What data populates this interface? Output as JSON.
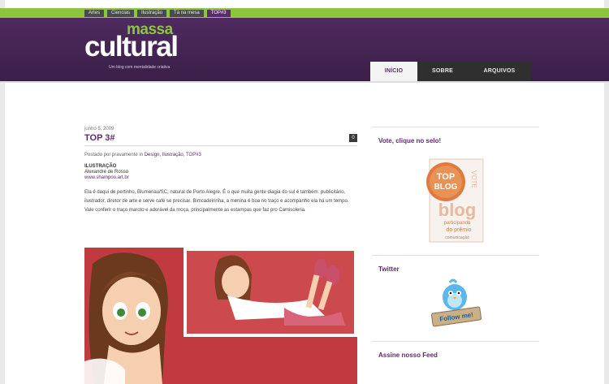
{
  "topnav": [
    "Artes",
    "Ciencias",
    "Ilustração",
    "Tá na mesa",
    "TOP#3"
  ],
  "logo": {
    "massa": "massa",
    "cultural": "cultural",
    "tagline": "Um blog com mentalidade criativa"
  },
  "mainnav": [
    {
      "label": "INÍCIO",
      "active": true
    },
    {
      "label": "SOBRE",
      "active": false
    },
    {
      "label": "ARQUIVOS",
      "active": false
    }
  ],
  "post": {
    "date": "junho 5, 2009",
    "title": "TOP 3#",
    "comment_count": "0",
    "meta_prefix": "Postado por pravamente in ",
    "meta_links": "Design, Ilustração, TOP#3",
    "section": "ILUSTRAÇÃO",
    "author": "Alexandre de Rosso",
    "url": "www.shampoo.art.br",
    "body": "Ela é daqui de pertinho, Blumenau/SC, natural de Porto Alegre. É o que muita gente diagia do sul é também: publicitário, ilustrador, diretor de arte e serve café se precisar. Bimcadeirinha, a menina é boa no traço e acompanho ela há um tempo. Vale conferir o traço maroto e adorável da moça, principalmente as estampas que faz pro Camisoleria."
  },
  "sidebar": {
    "vote_title": "Vote, clique no selo!",
    "badge": {
      "top": "TOP",
      "blog": "BLOG",
      "big": "blog",
      "line1": "participando",
      "line2": "do prêmio",
      "footer": "comunicação",
      "side": "VOTE"
    },
    "twitter_title": "Twitter",
    "twitter_button": "Follow me!",
    "feed_title": "Assine nosso Feed"
  },
  "colors": {
    "purple": "#5c2b6b",
    "green": "#8cc63f",
    "orange": "#e07a3e"
  }
}
